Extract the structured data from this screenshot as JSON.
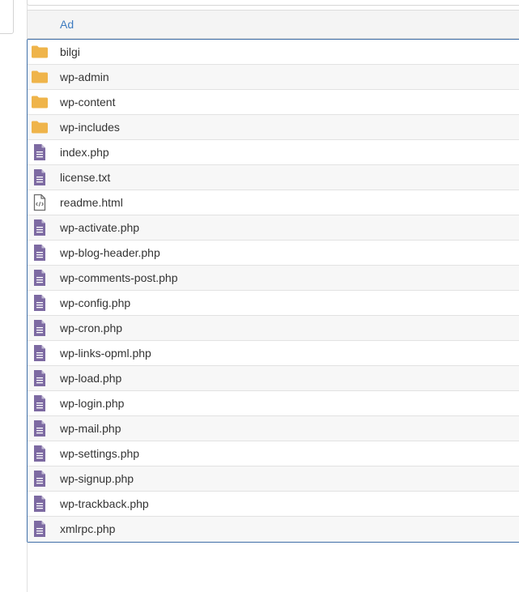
{
  "colors": {
    "folder": "#efb44a",
    "php_file": "#7d6aa2",
    "html_file": "#6b6b6b",
    "header_link": "#3d7bc0",
    "selection_border": "#3f6fa8"
  },
  "table": {
    "header": {
      "name_label": "Ad"
    },
    "rows": [
      {
        "name": "bilgi",
        "icon": "folder-icon"
      },
      {
        "name": "wp-admin",
        "icon": "folder-icon"
      },
      {
        "name": "wp-content",
        "icon": "folder-icon"
      },
      {
        "name": "wp-includes",
        "icon": "folder-icon"
      },
      {
        "name": "index.php",
        "icon": "text-file-icon"
      },
      {
        "name": "license.txt",
        "icon": "text-file-icon"
      },
      {
        "name": "readme.html",
        "icon": "code-file-icon"
      },
      {
        "name": "wp-activate.php",
        "icon": "text-file-icon"
      },
      {
        "name": "wp-blog-header.php",
        "icon": "text-file-icon"
      },
      {
        "name": "wp-comments-post.php",
        "icon": "text-file-icon"
      },
      {
        "name": "wp-config.php",
        "icon": "text-file-icon"
      },
      {
        "name": "wp-cron.php",
        "icon": "text-file-icon"
      },
      {
        "name": "wp-links-opml.php",
        "icon": "text-file-icon"
      },
      {
        "name": "wp-load.php",
        "icon": "text-file-icon"
      },
      {
        "name": "wp-login.php",
        "icon": "text-file-icon"
      },
      {
        "name": "wp-mail.php",
        "icon": "text-file-icon"
      },
      {
        "name": "wp-settings.php",
        "icon": "text-file-icon"
      },
      {
        "name": "wp-signup.php",
        "icon": "text-file-icon"
      },
      {
        "name": "wp-trackback.php",
        "icon": "text-file-icon"
      },
      {
        "name": "xmlrpc.php",
        "icon": "text-file-icon"
      }
    ]
  }
}
